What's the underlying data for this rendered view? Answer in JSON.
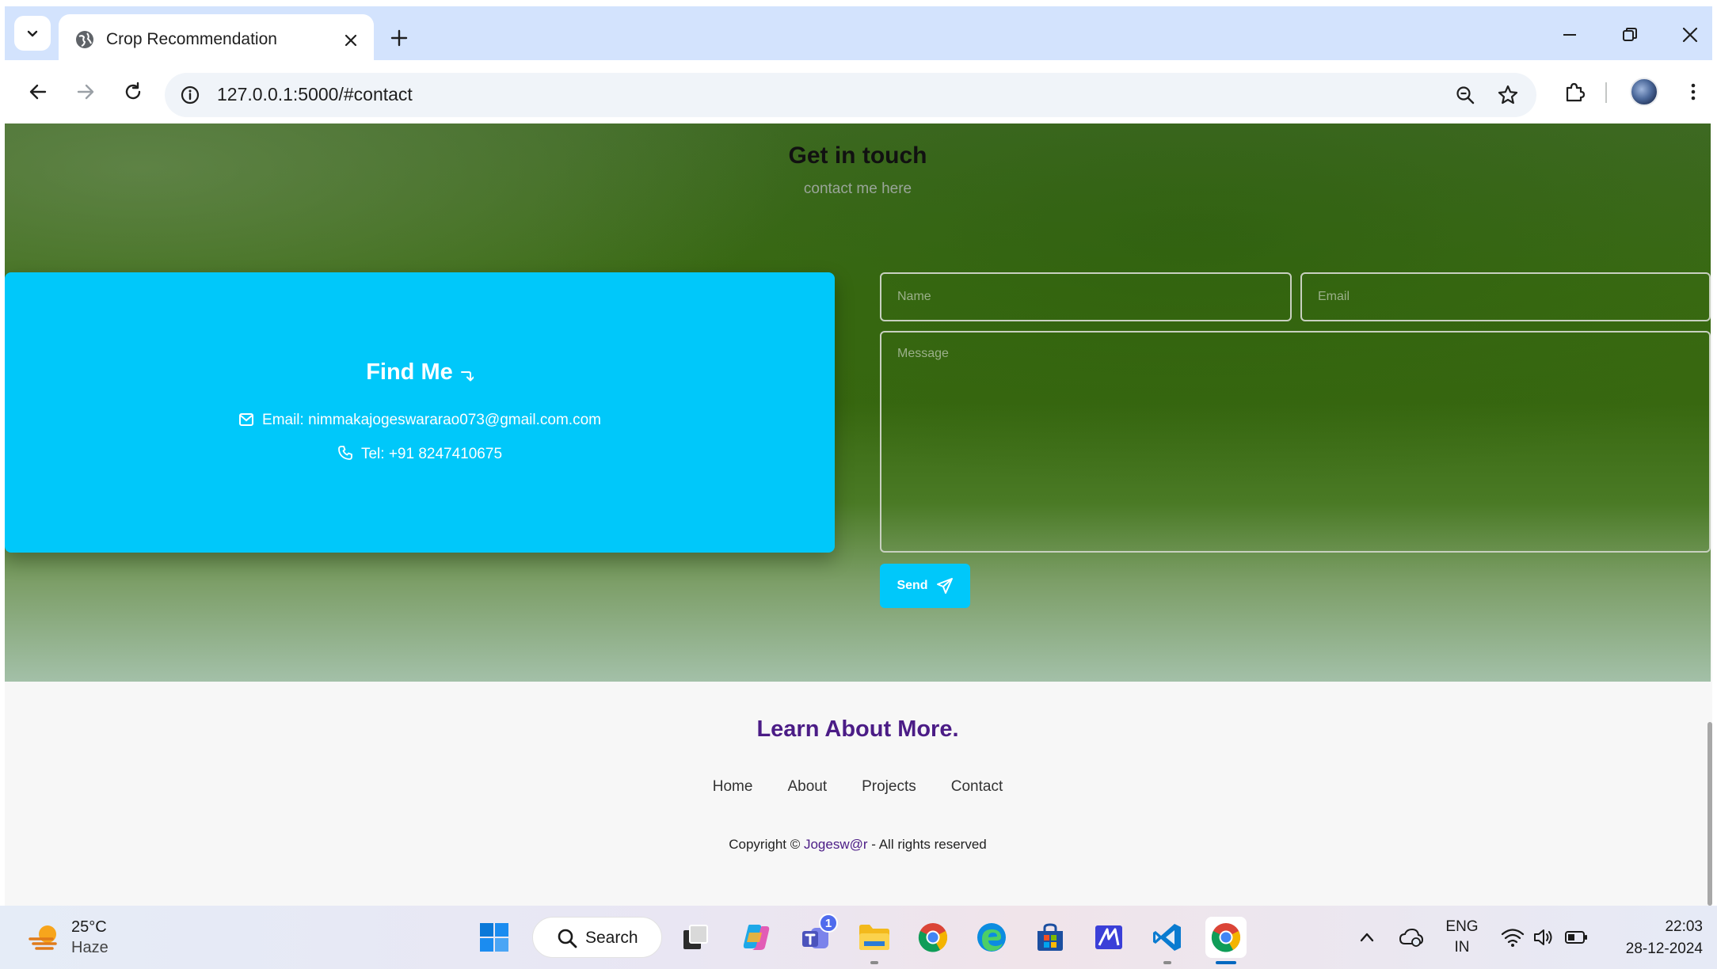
{
  "browser": {
    "tab_title": "Crop Recommendation",
    "url": "127.0.0.1:5000/#contact"
  },
  "contact": {
    "title": "Get in touch",
    "subtitle": "contact me here",
    "find_me": {
      "title": "Find Me",
      "email_text": "Email: nimmakajogeswararao073@gmail.com.com",
      "phone_text": "Tel: +91 8247410675"
    },
    "form": {
      "name_placeholder": "Name",
      "email_placeholder": "Email",
      "message_placeholder": "Message",
      "send_label": "Send"
    },
    "colors": {
      "accent": "#00c8fa"
    }
  },
  "footer": {
    "title": "Learn About More.",
    "nav": [
      "Home",
      "About",
      "Projects",
      "Contact"
    ],
    "copyright_prefix": "Copyright © ",
    "copyright_brand": "Jogesw@r",
    "copyright_suffix": " - All rights reserved",
    "colors": {
      "title": "#4b1c86"
    }
  },
  "taskbar": {
    "weather_temp": "25°C",
    "weather_desc": "Haze",
    "search_label": "Search",
    "teams_badge": "1",
    "lang_top": "ENG",
    "lang_bottom": "IN",
    "time": "22:03",
    "date": "28-12-2024"
  }
}
